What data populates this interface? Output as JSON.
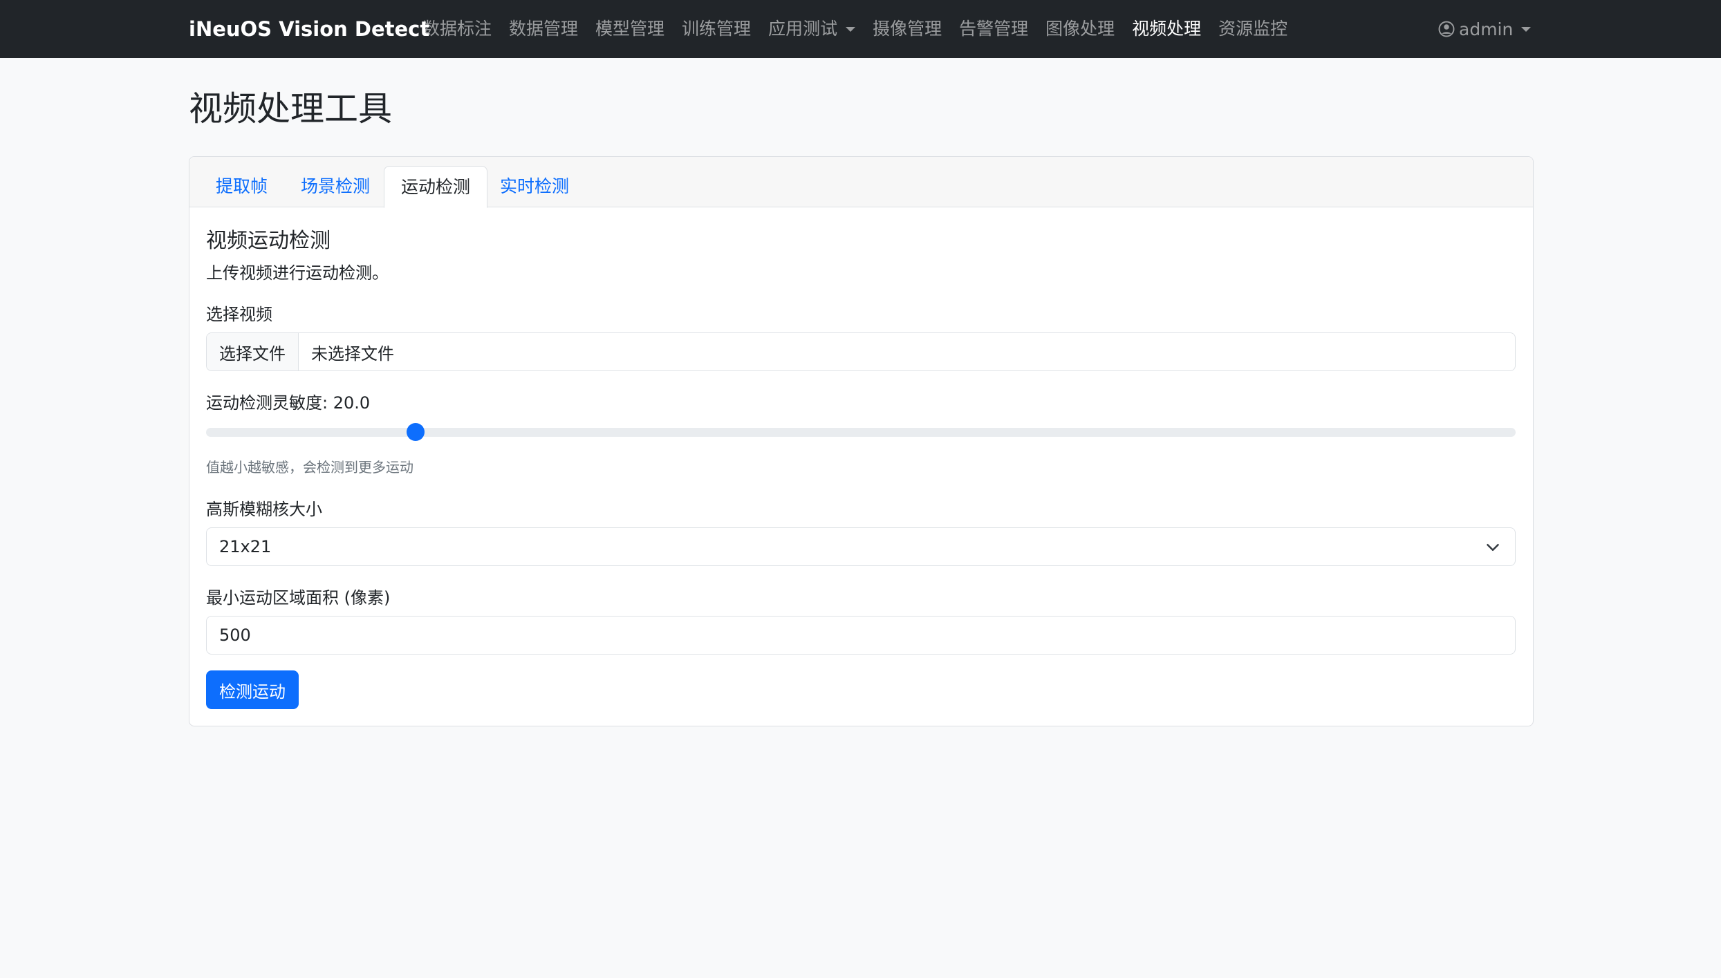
{
  "navbar": {
    "brand": "iNeuOS Vision Detect",
    "links": [
      {
        "label": "数据标注"
      },
      {
        "label": "数据管理"
      },
      {
        "label": "模型管理"
      },
      {
        "label": "训练管理"
      },
      {
        "label": "应用测试"
      },
      {
        "label": "摄像管理"
      },
      {
        "label": "告警管理"
      },
      {
        "label": "图像处理"
      },
      {
        "label": "视频处理"
      },
      {
        "label": "资源监控"
      }
    ],
    "active_link": "视频处理",
    "user": "admin"
  },
  "page": {
    "title": "视频处理工具"
  },
  "tabs": [
    {
      "label": "提取帧"
    },
    {
      "label": "场景检测"
    },
    {
      "label": "运动检测"
    },
    {
      "label": "实时检测"
    }
  ],
  "active_tab": "运动检测",
  "form": {
    "section_title": "视频运动检测",
    "section_desc": "上传视频进行运动检测。",
    "video_label": "选择视频",
    "file_button": "选择文件",
    "file_status": "未选择文件",
    "sensitivity_label": "运动检测灵敏度: 20.0",
    "sensitivity_fraction": 0.16,
    "sensitivity_help": "值越小越敏感，会检测到更多运动",
    "blur_label": "高斯模糊核大小",
    "blur_value": "21x21",
    "min_area_label": "最小运动区域面积 (像素)",
    "min_area_value": "500",
    "submit_button": "检测运动"
  },
  "colors": {
    "navbar_bg": "#212529",
    "primary": "#0d6efd",
    "page_bg": "#f8f9fa"
  }
}
